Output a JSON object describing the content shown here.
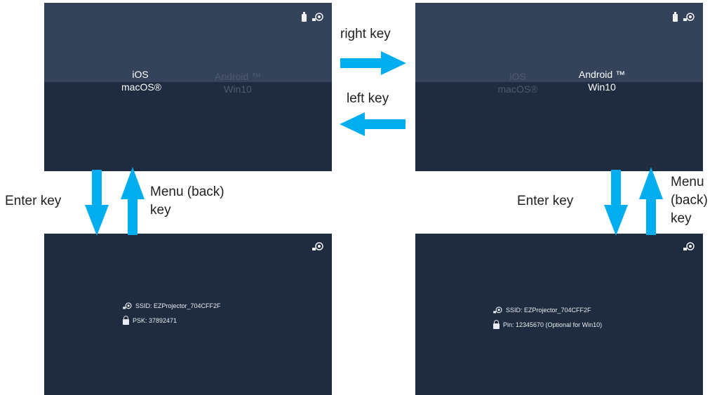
{
  "screens": {
    "top_left": {
      "options_left": {
        "line1": "iOS",
        "line2": "macOS®"
      },
      "options_right": {
        "line1": "Android ™",
        "line2": "Win10"
      },
      "selected": "left"
    },
    "top_right": {
      "options_left": {
        "line1": "iOS",
        "line2": "macOS®"
      },
      "options_right": {
        "line1": "Android ™",
        "line2": "Win10"
      },
      "selected": "right"
    },
    "bottom_left": {
      "ssid": "SSID: EZProjector_704CFF2F",
      "credential": "PSK: 37892471"
    },
    "bottom_right": {
      "ssid": "SSID: EZProjector_704CFF2F",
      "credential": "Pin: 12345670 (Optional for Win10)"
    }
  },
  "labels": {
    "right_key": "right key",
    "left_key": "left key",
    "enter_key_left": "Enter key",
    "menu_key_left_line1": "Menu (back)",
    "menu_key_left_line2": "key",
    "enter_key_right": "Enter key",
    "menu_key_right_line1": "Menu",
    "menu_key_right_line2": "(back)",
    "menu_key_right_line3": "key"
  },
  "colors": {
    "arrow": "#00aeef",
    "screen_top": "#35435a",
    "screen_bottom": "#1f2b3e"
  },
  "icons": [
    "usb-drive-icon",
    "wifi-status-icon",
    "lock-icon"
  ]
}
